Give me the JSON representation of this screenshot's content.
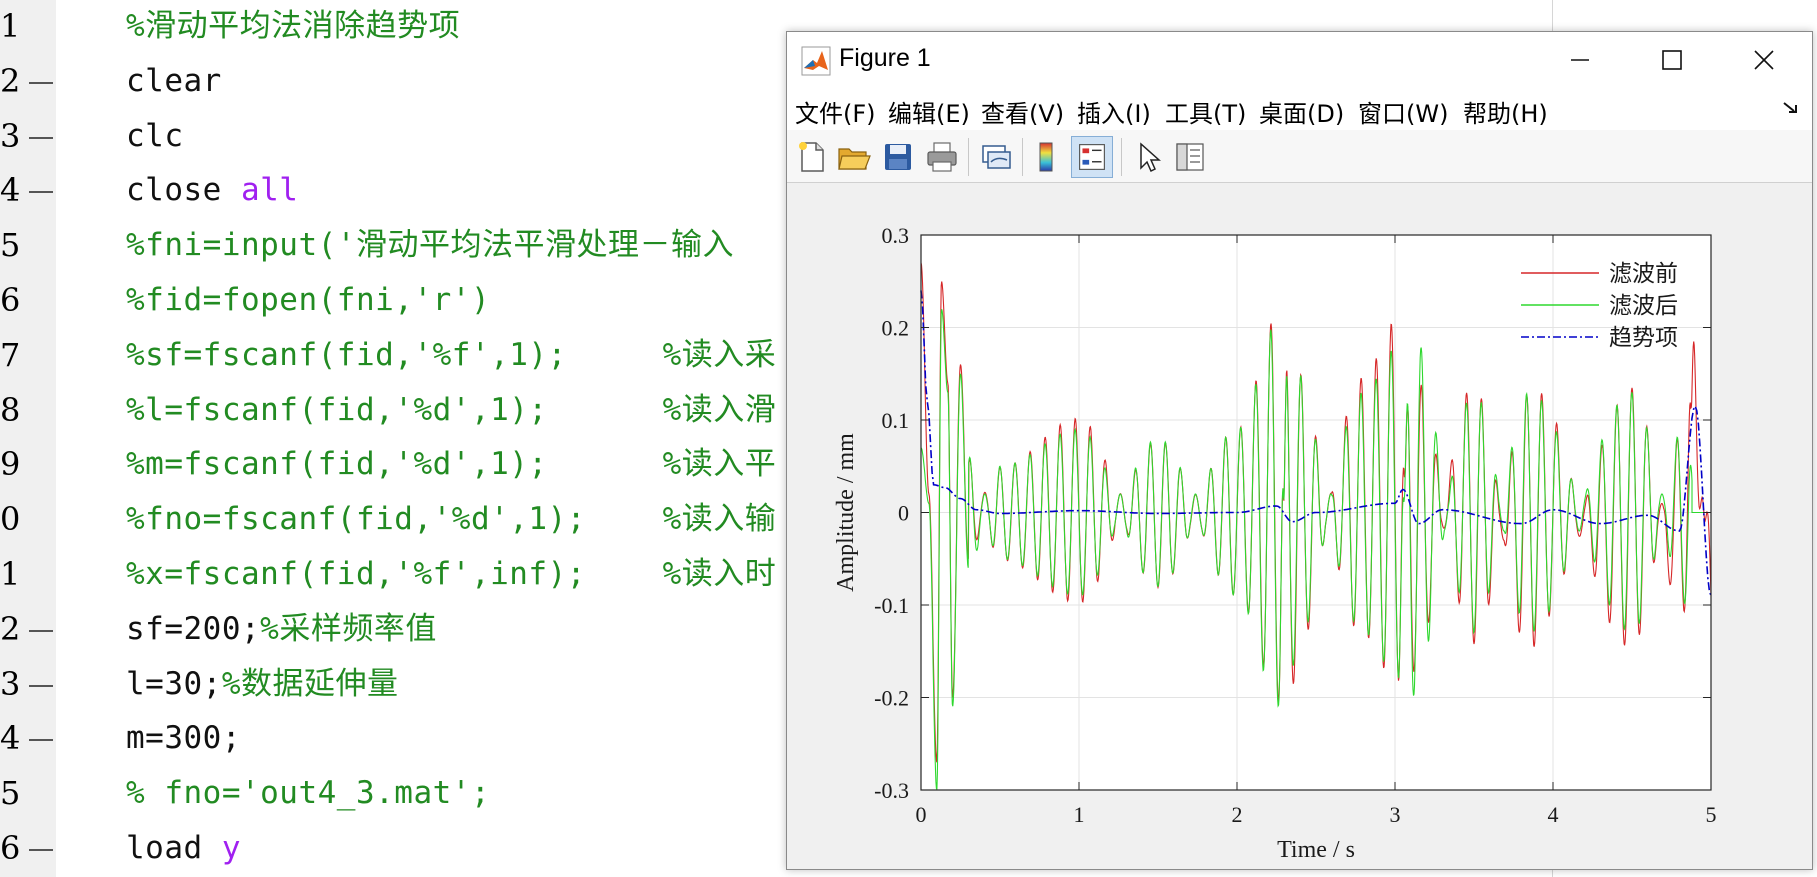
{
  "editor": {
    "lines": [
      {
        "num": "1",
        "bp": false,
        "segments": [
          {
            "t": "%滑动平均法消除趋势项",
            "c": "comment"
          }
        ]
      },
      {
        "num": "2",
        "bp": true,
        "segments": [
          {
            "t": "clear",
            "c": "plain"
          }
        ]
      },
      {
        "num": "3",
        "bp": true,
        "segments": [
          {
            "t": "clc",
            "c": "plain"
          }
        ]
      },
      {
        "num": "4",
        "bp": true,
        "segments": [
          {
            "t": "close ",
            "c": "plain"
          },
          {
            "t": "all",
            "c": "keyword"
          }
        ]
      },
      {
        "num": "5",
        "bp": false,
        "segments": [
          {
            "t": "%fni=input('滑动平均法平滑处理－输入",
            "c": "comment"
          }
        ]
      },
      {
        "num": "6",
        "bp": false,
        "segments": [
          {
            "t": "%fid=fopen(fni,'r')",
            "c": "comment"
          }
        ]
      },
      {
        "num": "7",
        "bp": false,
        "segments": [
          {
            "t": "%sf=fscanf(fid,'%f',1);     %读入采",
            "c": "comment"
          }
        ]
      },
      {
        "num": "8",
        "bp": false,
        "segments": [
          {
            "t": "%l=fscanf(fid,'%d',1);      %读入滑",
            "c": "comment"
          }
        ]
      },
      {
        "num": "9",
        "bp": false,
        "segments": [
          {
            "t": "%m=fscanf(fid,'%d',1);      %读入平",
            "c": "comment"
          }
        ]
      },
      {
        "num": "0",
        "bp": false,
        "segments": [
          {
            "t": "%fno=fscanf(fid,'%d',1);    %读入输",
            "c": "comment"
          }
        ]
      },
      {
        "num": "1",
        "bp": false,
        "segments": [
          {
            "t": "%x=fscanf(fid,'%f',inf);    %读入时",
            "c": "comment"
          }
        ]
      },
      {
        "num": "2",
        "bp": true,
        "segments": [
          {
            "t": "sf=200;",
            "c": "plain"
          },
          {
            "t": "%采样频率值",
            "c": "comment"
          }
        ]
      },
      {
        "num": "3",
        "bp": true,
        "segments": [
          {
            "t": "l=30;",
            "c": "plain"
          },
          {
            "t": "%数据延伸量",
            "c": "comment"
          }
        ]
      },
      {
        "num": "4",
        "bp": true,
        "segments": [
          {
            "t": "m=300;",
            "c": "plain"
          }
        ]
      },
      {
        "num": "5",
        "bp": false,
        "segments": [
          {
            "t": "% fno='out4_3.mat';",
            "c": "comment"
          }
        ]
      },
      {
        "num": "6",
        "bp": true,
        "segments": [
          {
            "t": "load ",
            "c": "plain"
          },
          {
            "t": "y",
            "c": "keyword"
          }
        ]
      }
    ]
  },
  "figure": {
    "title": "Figure 1",
    "menus": [
      "文件(F)",
      "编辑(E)",
      "查看(V)",
      "插入(I)",
      "工具(T)",
      "桌面(D)",
      "窗口(W)",
      "帮助(H)"
    ],
    "toolbar_icons": [
      "new-figure-icon",
      "open-file-icon",
      "save-icon",
      "print-icon",
      "link-plot-icon",
      "insert-colorbar-icon",
      "insert-legend-icon",
      "edit-plot-icon",
      "property-inspector-icon"
    ]
  },
  "colors": {
    "comment": "#228b22",
    "keyword": "#a020f0",
    "series_before": "#d62728",
    "series_after": "#2ed82e",
    "series_trend": "#0000c8"
  },
  "chart_data": {
    "type": "line",
    "xlabel": "Time / s",
    "ylabel": "Amplitude / mm",
    "xlim": [
      0,
      5
    ],
    "ylim": [
      -0.3,
      0.3
    ],
    "xticks": [
      "0",
      "1",
      "2",
      "3",
      "4",
      "5"
    ],
    "yticks": [
      "0.3",
      "0.2",
      "0.1",
      "0",
      "-0.1",
      "-0.2",
      "-0.3"
    ],
    "grid": true,
    "legend_position": "top-right",
    "series": [
      {
        "name": "滤波前",
        "style": "solid",
        "x": [
          0,
          0.05,
          0.1,
          0.13,
          0.17,
          0.2,
          0.25,
          0.3,
          0.5,
          1,
          1.5,
          2,
          2.27,
          2.32,
          2.8,
          3.02,
          3.1,
          3.5,
          3.85,
          4.5,
          4.85,
          4.9,
          5
        ],
        "y": [
          0.27,
          0.02,
          -0.27,
          0.25,
          0.14,
          -0.2,
          0.16,
          -0.05,
          0.05,
          0.1,
          -0.08,
          0.09,
          0.21,
          -0.18,
          0.14,
          0.2,
          -0.17,
          0.14,
          -0.14,
          0.14,
          -0.12,
          0.11,
          -0.09
        ]
      },
      {
        "name": "滤波后",
        "style": "solid",
        "x": [
          0,
          0.05,
          0.1,
          0.13,
          0.17,
          0.2,
          0.25,
          0.3,
          0.5,
          1,
          1.5,
          2,
          2.27,
          2.32,
          2.8,
          3.02,
          3.1,
          3.5,
          3.85,
          4.5,
          4.85,
          4.9,
          5
        ],
        "y": [
          0.07,
          0.01,
          -0.3,
          0.22,
          0.13,
          -0.21,
          0.15,
          -0.06,
          0.05,
          0.09,
          -0.08,
          0.09,
          0.21,
          -0.17,
          0.13,
          0.18,
          -0.2,
          0.13,
          -0.13,
          0.13,
          -0.1,
          0,
          0
        ]
      },
      {
        "name": "趋势项",
        "style": "dashdot",
        "x": [
          0,
          0.04,
          0.08,
          0.15,
          0.25,
          0.35,
          0.5,
          1,
          1.5,
          2,
          2.25,
          2.35,
          2.5,
          3,
          3.05,
          3.15,
          3.3,
          3.8,
          4,
          4.3,
          4.6,
          4.8,
          4.9,
          5
        ],
        "y": [
          0.24,
          0.12,
          0.03,
          0.027,
          0.015,
          0.003,
          -0.001,
          0.002,
          -0.001,
          0,
          0.007,
          -0.01,
          0,
          0.01,
          0.025,
          -0.012,
          0.003,
          -0.012,
          0.003,
          -0.012,
          -0.003,
          -0.02,
          0.115,
          -0.09
        ]
      }
    ]
  }
}
